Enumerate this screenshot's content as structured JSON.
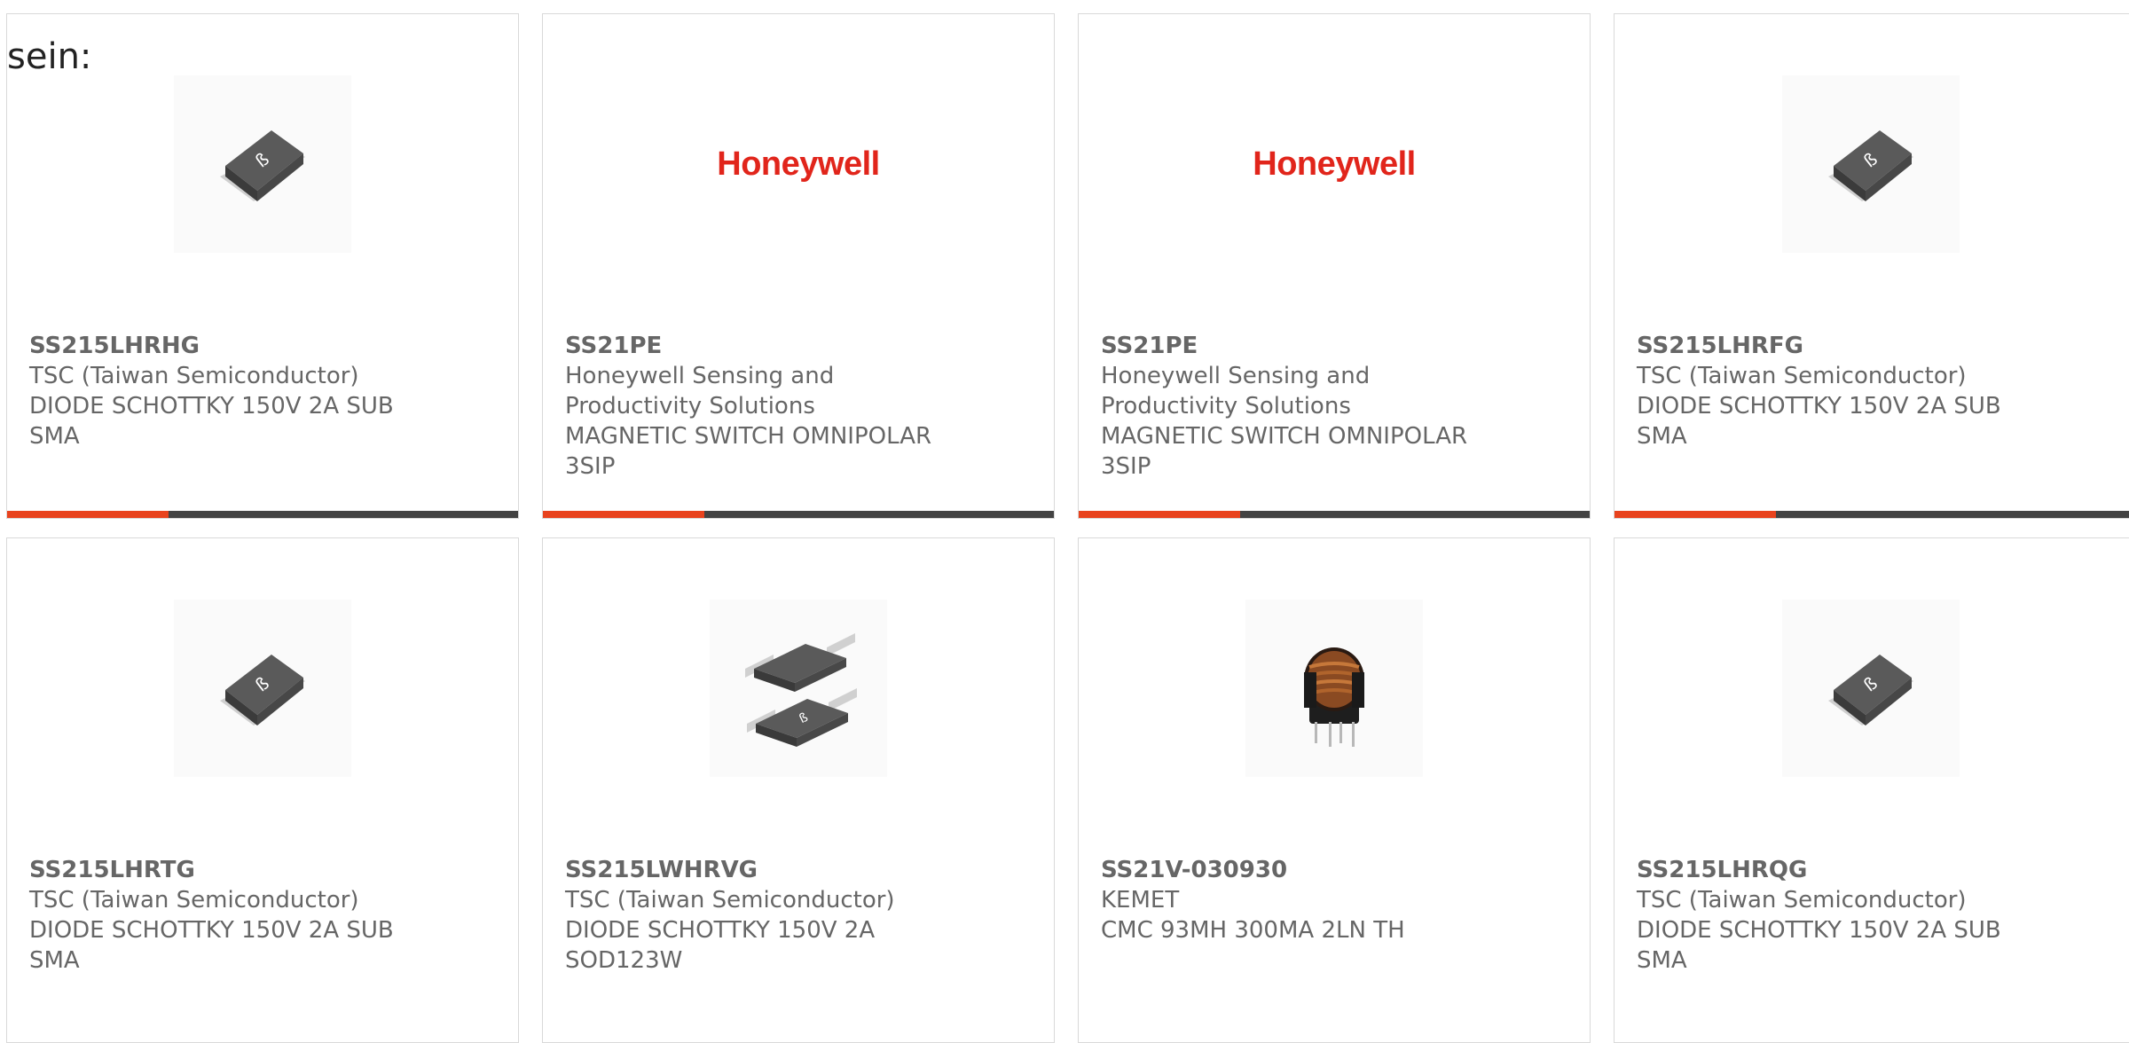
{
  "intro": "sein:",
  "cards": [
    {
      "part": "SS215LHRHG",
      "manufacturer": "TSC (Taiwan Semiconductor)",
      "description": "DIODE SCHOTTKY 150V 2A SUB SMA",
      "image": "sma-diode-icon"
    },
    {
      "part": "SS21PE",
      "manufacturer": "Honeywell Sensing and Productivity Solutions",
      "description": "MAGNETIC SWITCH OMNIPOLAR 3SIP",
      "image": "honeywell-logo",
      "logo_text": "Honeywell"
    },
    {
      "part": "SS21PE",
      "manufacturer": "Honeywell Sensing and Productivity Solutions",
      "description": "MAGNETIC SWITCH OMNIPOLAR 3SIP",
      "image": "honeywell-logo",
      "logo_text": "Honeywell"
    },
    {
      "part": "SS215LHRFG",
      "manufacturer": "TSC (Taiwan Semiconductor)",
      "description": "DIODE SCHOTTKY 150V 2A SUB SMA",
      "image": "sma-diode-icon"
    },
    {
      "part": "SS215LHRTG",
      "manufacturer": "TSC (Taiwan Semiconductor)",
      "description": "DIODE SCHOTTKY 150V 2A SUB SMA",
      "image": "sma-diode-icon"
    },
    {
      "part": "SS215LWHRVG",
      "manufacturer": "TSC (Taiwan Semiconductor)",
      "description": "DIODE SCHOTTKY 150V 2A SOD123W",
      "image": "sod123w-diode-icon"
    },
    {
      "part": "SS21V-030930",
      "manufacturer": "KEMET",
      "description": "CMC 93MH 300MA 2LN TH",
      "image": "common-mode-choke-icon"
    },
    {
      "part": "SS215LHRQG",
      "manufacturer": "TSC (Taiwan Semiconductor)",
      "description": "DIODE SCHOTTKY 150V 2A SUB SMA",
      "image": "sma-diode-icon"
    }
  ],
  "colors": {
    "accent": "#e8431e",
    "bar": "#434343",
    "text": "#666666",
    "brand_red": "#e1251b"
  }
}
